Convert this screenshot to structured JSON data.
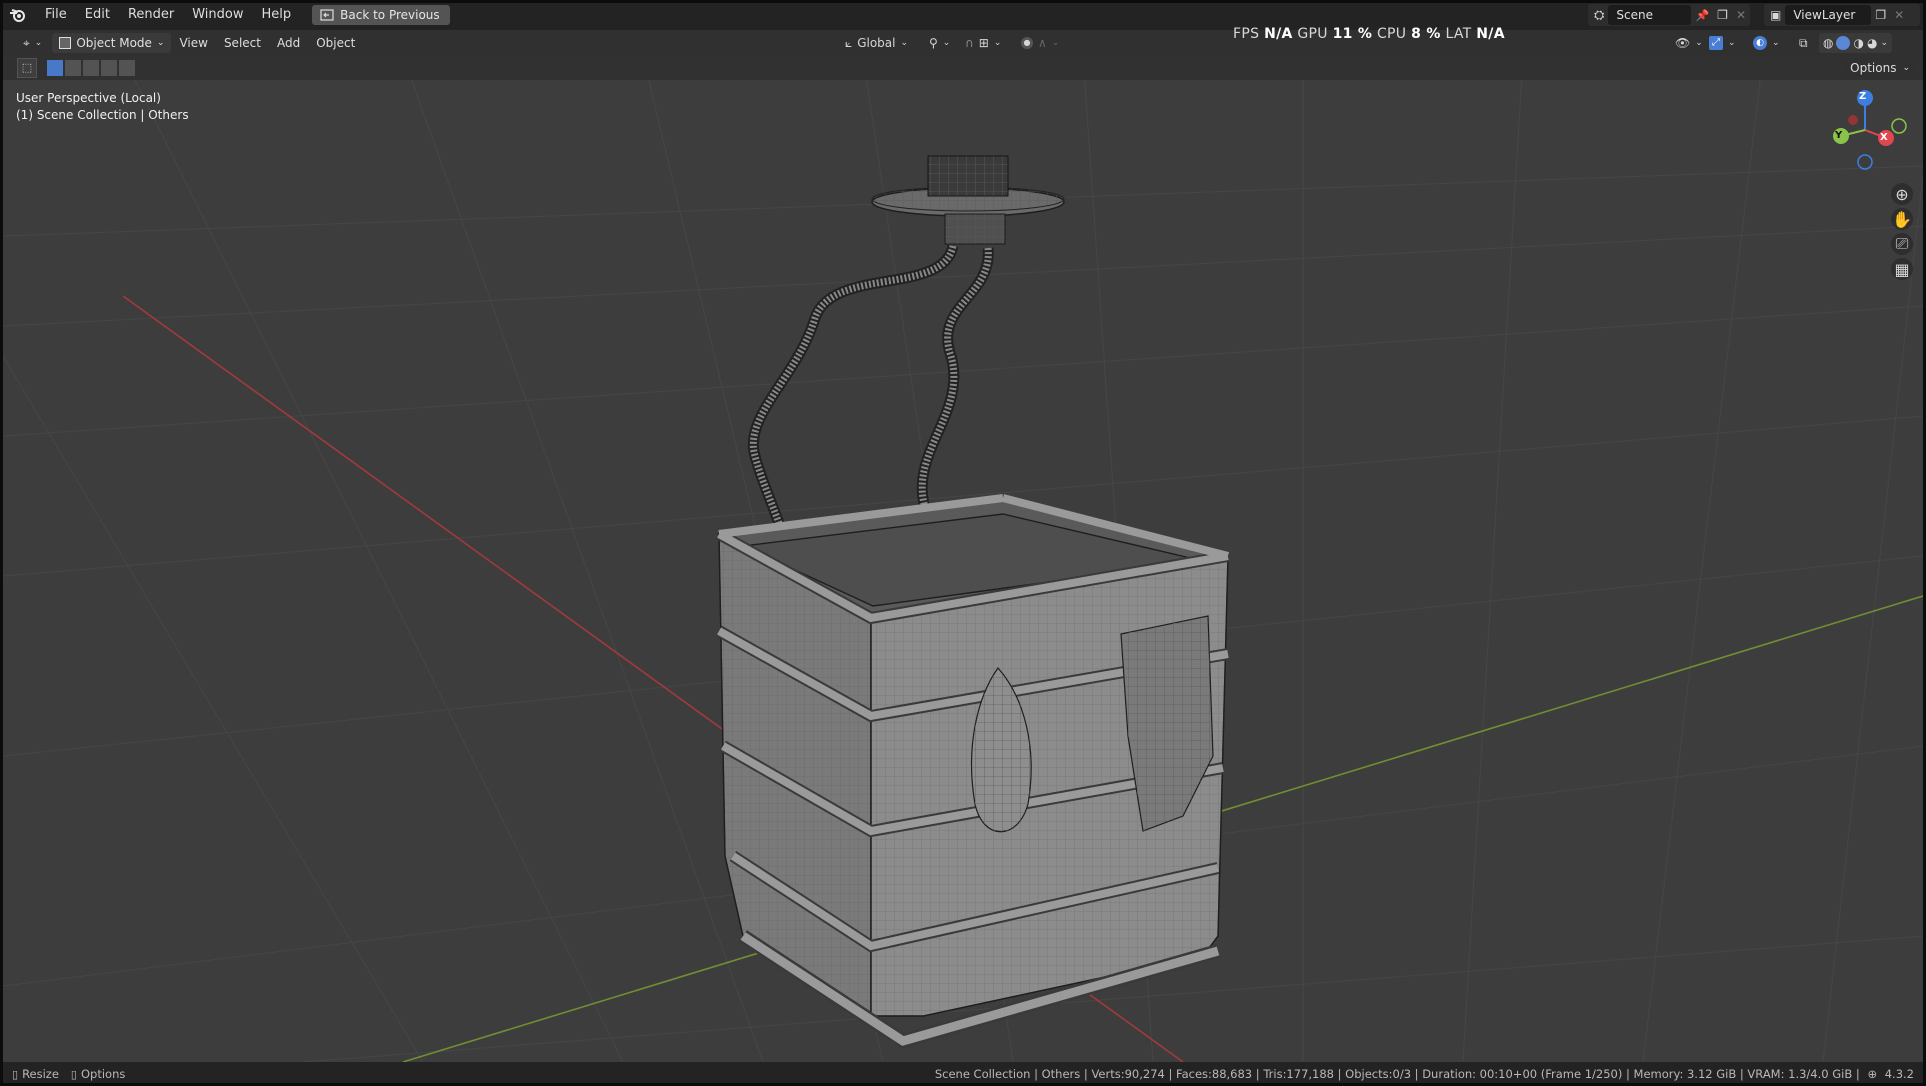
{
  "menubar": {
    "items": [
      "File",
      "Edit",
      "Render",
      "Window",
      "Help"
    ],
    "back_button": "Back to Previous",
    "scene": "Scene",
    "view_layer": "ViewLayer"
  },
  "header": {
    "mode": "Object Mode",
    "menus": [
      "View",
      "Select",
      "Add",
      "Object"
    ],
    "orientation": "Global",
    "options": "Options"
  },
  "stats": {
    "fps_label": "FPS",
    "fps_value": "N/A",
    "gpu_label": "GPU",
    "gpu_value": "11 %",
    "cpu_label": "CPU",
    "cpu_value": "8 %",
    "lat_label": "LAT",
    "lat_value": "N/A"
  },
  "viewport": {
    "perspective": "User Perspective (Local)",
    "collection": "(1) Scene Collection | Others",
    "gizmo": {
      "x": "X",
      "y": "Y",
      "z": "Z"
    }
  },
  "statusbar": {
    "resize": "Resize",
    "options": "Options",
    "info": "Scene Collection | Others | Verts:90,274 | Faces:88,683 | Tris:177,188 | Objects:0/3 | Duration: 00:10+00 (Frame 1/250) | Memory: 3.12 GiB | VRAM: 1.3/4.0 GiB |",
    "version": "4.3.2"
  },
  "colors": {
    "viewport_bg": "#3d3d3d",
    "x_axis": "#b23a3a",
    "y_axis": "#7fa33a",
    "gizmo_x": "#e0474f",
    "gizmo_y": "#8bc34a",
    "gizmo_z": "#3d7fe0"
  }
}
